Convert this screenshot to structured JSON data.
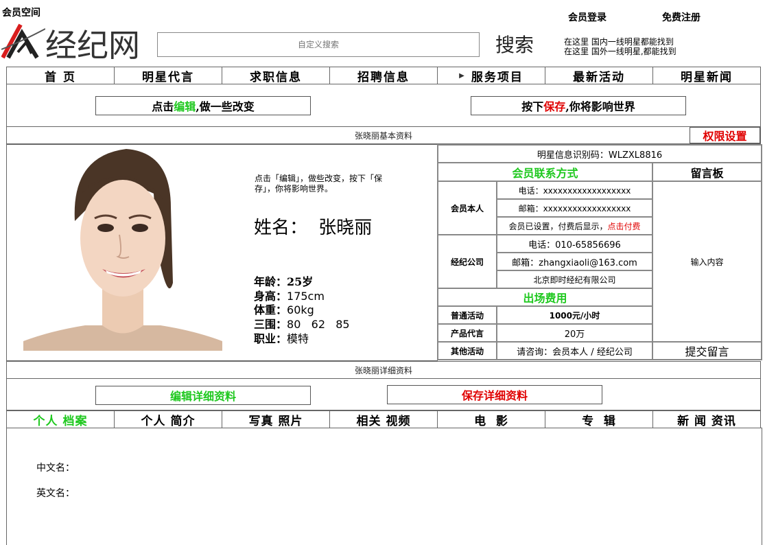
{
  "header": {
    "space_label": "会员空间",
    "login": "会员登录",
    "register": "免费注册",
    "logo_text": "经纪网",
    "search_placeholder": "自定义搜索",
    "search_button": "搜索",
    "hint_1": "在这里 国内一线明星都能找到",
    "hint_2": "在这里 国外一线明星,都能找到"
  },
  "nav": [
    "首 页",
    "明星代言",
    "求职信息",
    "招聘信息",
    "服务项目",
    "最新活动",
    "明星新闻"
  ],
  "edit_bar": {
    "edit_prefix": "点击 ",
    "edit_word": "编辑",
    "edit_suffix": " ,做一些改变",
    "save_prefix": "按下 ",
    "save_word": "保存",
    "save_suffix": ",你将影响世界"
  },
  "basic_section_title": "张晓丽基本资料",
  "permission_button": "权限设置",
  "profile": {
    "click_hint": "点击「编辑」，做些改变，按下「保存」，你将影响世界。",
    "name_label": "姓名：",
    "name": "张晓丽",
    "age_label": "年龄：",
    "age": "25岁",
    "height_label": "身高：",
    "height": "175cm",
    "weight_label": "体重：",
    "weight": "60kg",
    "measurements_label": "三围：",
    "measurements": "80   62   85",
    "job_label": "职业：",
    "job": "模特"
  },
  "contact": {
    "id_code": "明星信息识别码：WLZXL8816",
    "contact_title": "会员联系方式",
    "message_board_title": "留言板",
    "member_label": "会员本人",
    "member_phone": "电话：xxxxxxxxxxxxxxxxxx",
    "member_email": "邮箱：xxxxxxxxxxxxxxxxxx",
    "member_note": "会员已设置，付费后显示，",
    "pay_link": "点击付费",
    "agency_label": "经纪公司",
    "agency_phone": "电话：010-65856696",
    "agency_email": "邮箱：zhangxiaoli@163.com",
    "agency_name": "北京即时经纪有限公司",
    "message_placeholder": "输入内容",
    "fee_title": "出场费用",
    "fees": [
      {
        "label": "普通活动",
        "value": "1000元/小时"
      },
      {
        "label": "产品代言",
        "value": "20万"
      },
      {
        "label": "其他活动",
        "value": "请咨询：会员本人 / 经纪公司"
      }
    ],
    "submit_message": "提交留言"
  },
  "detail_section_title": "张晓丽详细资料",
  "detail_buttons": {
    "edit": "编辑详细资料",
    "save": "保存详细资料"
  },
  "tabs": [
    "个人 档案",
    "个人 简介",
    "写真 照片",
    "相关 视频",
    "电  影",
    "专  辑",
    "新 闻 资讯"
  ],
  "profile_fields": [
    "中文名：",
    "英文名："
  ],
  "colors": {
    "green": "#1ec81e",
    "red": "#e00000",
    "border": "#666666"
  }
}
